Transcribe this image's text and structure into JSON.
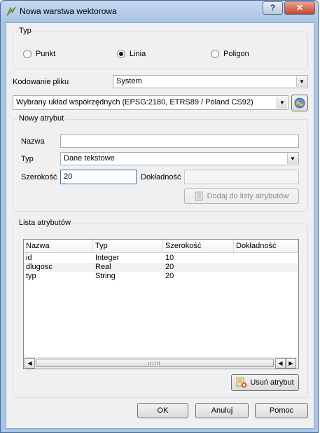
{
  "window": {
    "title": "Nowa warstwa wektorowa",
    "help_label": "?",
    "close_label": "✕"
  },
  "type_group": {
    "title": "Typ",
    "options": [
      {
        "label": "Punkt",
        "checked": false
      },
      {
        "label": "Linia",
        "checked": true
      },
      {
        "label": "Poligon",
        "checked": false
      }
    ]
  },
  "encoding": {
    "label": "Kodowanie pliku",
    "value": "System"
  },
  "crs": {
    "value": "Wybrany układ współrzędnych (EPSG:2180, ETRS89 / Poland CS92)"
  },
  "new_attribute": {
    "title": "Nowy atrybut",
    "name_label": "Nazwa",
    "name_value": "",
    "type_label": "Typ",
    "type_value": "Dane tekstowe",
    "width_label": "Szerokość",
    "width_value": "20",
    "precision_label": "Dokładność",
    "precision_value": "",
    "add_button_label": "Dodaj do listy atrybutów"
  },
  "attribute_list": {
    "title": "Lista atrybutów",
    "columns": [
      "Nazwa",
      "Typ",
      "Szerokość",
      "Dokładność"
    ],
    "rows": [
      [
        "id",
        "Integer",
        "10",
        ""
      ],
      [
        "dlugosc",
        "Real",
        "20",
        ""
      ],
      [
        "typ",
        "String",
        "20",
        ""
      ]
    ],
    "remove_button_label": "Usuń atrybut"
  },
  "footer": {
    "ok_label": "OK",
    "cancel_label": "Anuluj",
    "help_label": "Pomoc"
  }
}
